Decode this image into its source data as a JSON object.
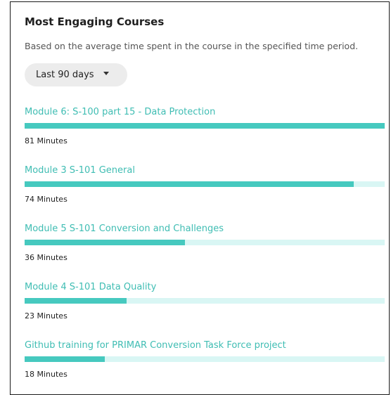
{
  "card": {
    "title": "Most Engaging Courses",
    "subtitle": "Based on the average time spent in the course in the specified time period."
  },
  "filter": {
    "selected": "Last 90 days"
  },
  "max_minutes": 81,
  "courses": [
    {
      "name": "Module 6: S-100 part 15 - Data Protection",
      "minutes": 81,
      "minutes_label": "81 Minutes"
    },
    {
      "name": "Module 3 S-101 General",
      "minutes": 74,
      "minutes_label": "74 Minutes"
    },
    {
      "name": "Module 5 S-101 Conversion and Challenges",
      "minutes": 36,
      "minutes_label": "36 Minutes"
    },
    {
      "name": "Module 4 S-101 Data Quality",
      "minutes": 23,
      "minutes_label": "23 Minutes"
    },
    {
      "name": "Github training for PRIMAR Conversion Task Force project",
      "minutes": 18,
      "minutes_label": "18 Minutes"
    }
  ],
  "colors": {
    "accent": "#46c9bf",
    "track": "#d9f6f4",
    "link": "#3fbdb3"
  }
}
